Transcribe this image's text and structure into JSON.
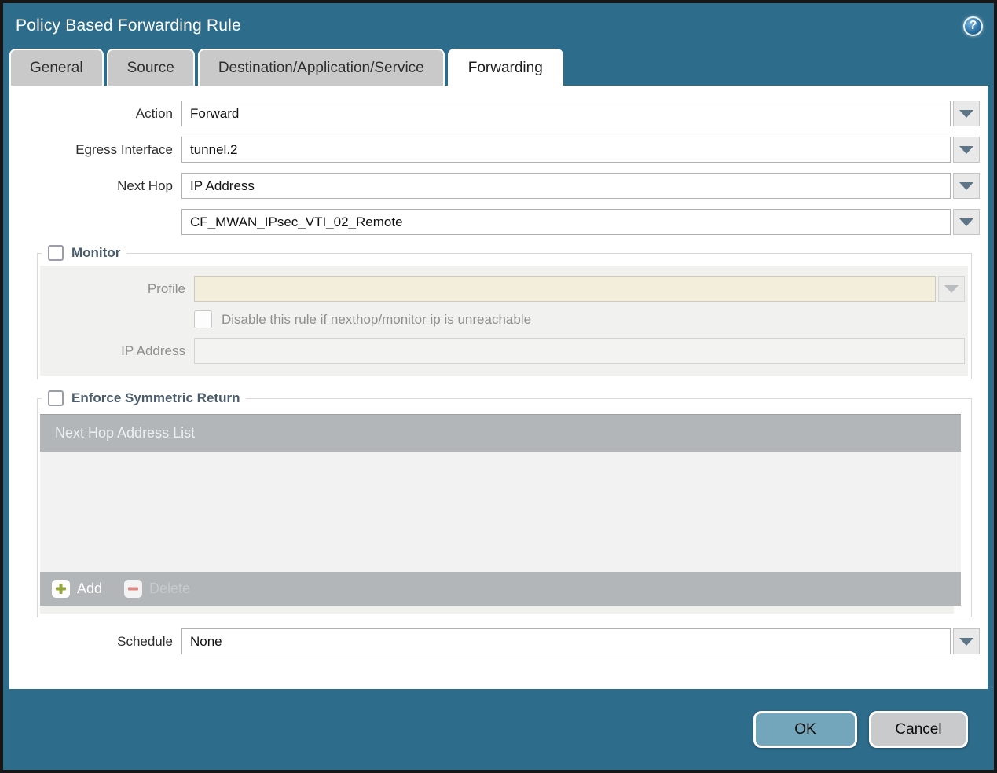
{
  "dialog": {
    "title": "Policy Based Forwarding Rule",
    "help_glyph": "?"
  },
  "tabs": [
    {
      "label": "General",
      "active": false
    },
    {
      "label": "Source",
      "active": false
    },
    {
      "label": "Destination/Application/Service",
      "active": false
    },
    {
      "label": "Forwarding",
      "active": true
    }
  ],
  "form": {
    "action": {
      "label": "Action",
      "value": "Forward"
    },
    "egress_interface": {
      "label": "Egress Interface",
      "value": "tunnel.2"
    },
    "next_hop": {
      "label": "Next Hop",
      "value": "IP Address"
    },
    "next_hop_address": {
      "value": "CF_MWAN_IPsec_VTI_02_Remote"
    },
    "schedule": {
      "label": "Schedule",
      "value": "None"
    }
  },
  "monitor": {
    "legend": "Monitor",
    "checked": false,
    "profile": {
      "label": "Profile",
      "value": ""
    },
    "disable_rule_label": "Disable this rule if nexthop/monitor ip is unreachable",
    "disable_rule_checked": false,
    "ip_address": {
      "label": "IP Address",
      "value": ""
    }
  },
  "symmetric_return": {
    "legend": "Enforce Symmetric Return",
    "checked": false,
    "table": {
      "header": "Next Hop Address List",
      "rows": []
    },
    "add_label": "Add",
    "delete_label": "Delete",
    "delete_enabled": false
  },
  "footer": {
    "ok_label": "OK",
    "cancel_label": "Cancel"
  },
  "colors": {
    "chrome_teal": "#2e6c8c",
    "ok_button": "#74a6bb",
    "cancel_button": "#c9cacc",
    "table_header": "#b2b6b9",
    "disabled_profile_field": "#f2eedb",
    "add_icon_green": "#94a63e",
    "delete_icon_red": "#dc8984"
  }
}
